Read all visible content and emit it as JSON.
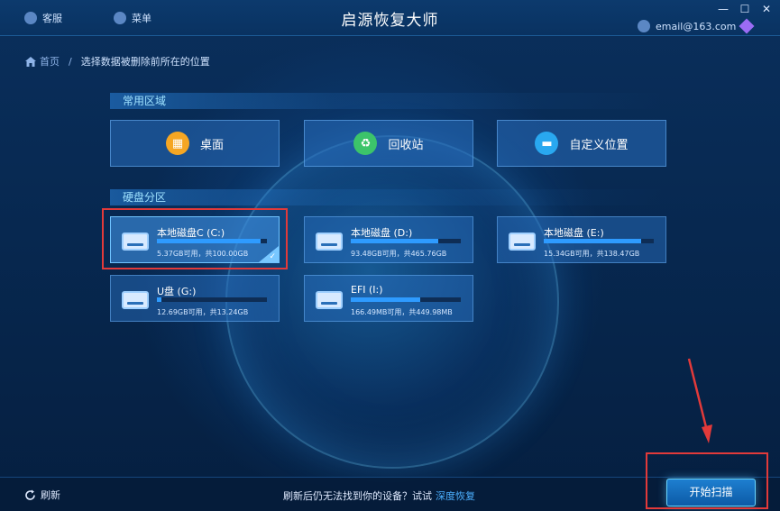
{
  "app": {
    "title": "启源恢复大师",
    "service_label": "客服",
    "menu_label": "菜单",
    "user_email": "email@163.com"
  },
  "window_controls": {
    "minimize": "—",
    "maximize": "☐",
    "close": "✕"
  },
  "breadcrumb": {
    "home": "首页",
    "separator": "/",
    "current": "选择数据被删除前所在的位置"
  },
  "sections": {
    "common": "常用区域",
    "disks": "硬盘分区"
  },
  "common_locations": [
    {
      "label": "桌面",
      "icon": "desktop-grid-icon",
      "color": "#f5a623"
    },
    {
      "label": "回收站",
      "icon": "recycle-icon",
      "color": "#3cc46a"
    },
    {
      "label": "自定义位置",
      "icon": "folder-icon",
      "color": "#29a8f0"
    }
  ],
  "drives": [
    {
      "name": "本地磁盘C (C:)",
      "size": "5.37GB可用，共100.00GB",
      "free_fraction": 0.946,
      "icon": "hard-drive-icon",
      "selected": true
    },
    {
      "name": "本地磁盘 (D:)",
      "size": "93.48GB可用，共465.76GB",
      "free_fraction": 0.799,
      "icon": "cloud-drive-icon",
      "selected": false
    },
    {
      "name": "本地磁盘 (E:)",
      "size": "15.34GB可用，共138.47GB",
      "free_fraction": 0.889,
      "icon": "cloud-drive-icon",
      "selected": false
    },
    {
      "name": "U盘 (G:)",
      "size": "12.69GB可用，共13.24GB",
      "free_fraction": 0.042,
      "icon": "usb-drive-icon",
      "selected": false
    },
    {
      "name": "EFI (I:)",
      "size": "166.49MB可用，共449.98MB",
      "free_fraction": 0.63,
      "icon": "usb-drive-icon",
      "selected": false
    }
  ],
  "bottom": {
    "refresh": "刷新",
    "hint": "刷新后仍无法找到你的设备？试试",
    "hint_link": "深度恢复",
    "scan_button": "开始扫描"
  },
  "colors": {
    "accent": "#2e9bff",
    "annotation_red": "#e23a3a"
  }
}
